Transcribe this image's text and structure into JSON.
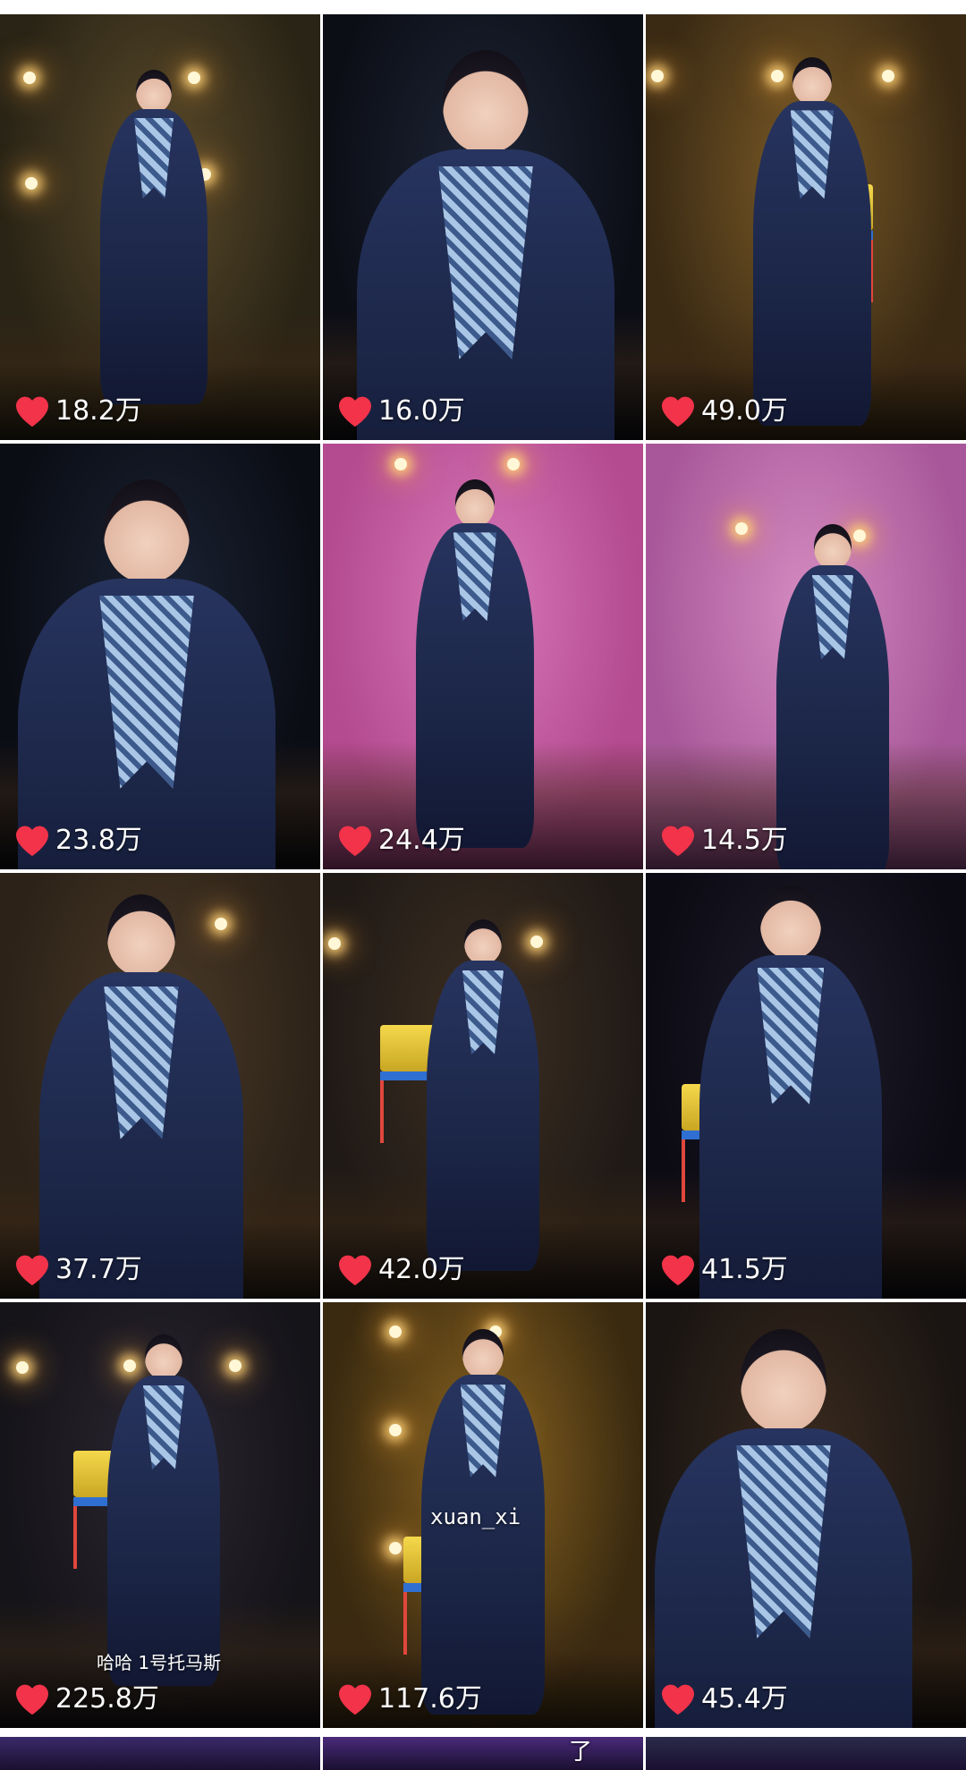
{
  "feed": {
    "tiles": [
      {
        "likes": "18.2万",
        "caption": "",
        "bg": "#2a2416",
        "spot": "#5a4a2a"
      },
      {
        "likes": "16.0万",
        "caption": "",
        "bg": "#0c0e16",
        "spot": "#1d2435"
      },
      {
        "likes": "49.0万",
        "caption": "",
        "bg": "#3a2a14",
        "spot": "#7a5a26"
      },
      {
        "likes": "23.8万",
        "caption": "",
        "bg": "#0b0d15",
        "spot": "#1a2233"
      },
      {
        "likes": "24.4万",
        "caption": "",
        "bg": "#b44a8f",
        "spot": "#d778b9"
      },
      {
        "likes": "14.5万",
        "caption": "",
        "bg": "#a8589a",
        "spot": "#d48ac0"
      },
      {
        "likes": "37.7万",
        "caption": "",
        "bg": "#2c2218",
        "spot": "#4a3a28"
      },
      {
        "likes": "42.0万",
        "caption": "",
        "bg": "#201a16",
        "spot": "#3d2f22"
      },
      {
        "likes": "41.5万",
        "caption": "",
        "bg": "#0c0b14",
        "spot": "#1e1c2a"
      },
      {
        "likes": "225.8万",
        "caption": "哈哈 1号托马斯",
        "bg": "#151419",
        "spot": "#2b2630"
      },
      {
        "likes": "117.6万",
        "caption": "xuan_xi",
        "bg": "#3a2a10",
        "spot": "#8a6420"
      },
      {
        "likes": "45.4万",
        "caption": "",
        "bg": "#1a1512",
        "spot": "#3a2a1e"
      }
    ],
    "partial_row": [
      {
        "bg": "#3a2a6a",
        "caption": ""
      },
      {
        "bg": "#4a2a7a",
        "caption": "了"
      },
      {
        "bg": "#2a2a4a",
        "caption": ""
      }
    ]
  },
  "colors": {
    "heart": "#f2334a",
    "background": "#ffffff"
  },
  "icons": {
    "like": "heart-icon"
  }
}
